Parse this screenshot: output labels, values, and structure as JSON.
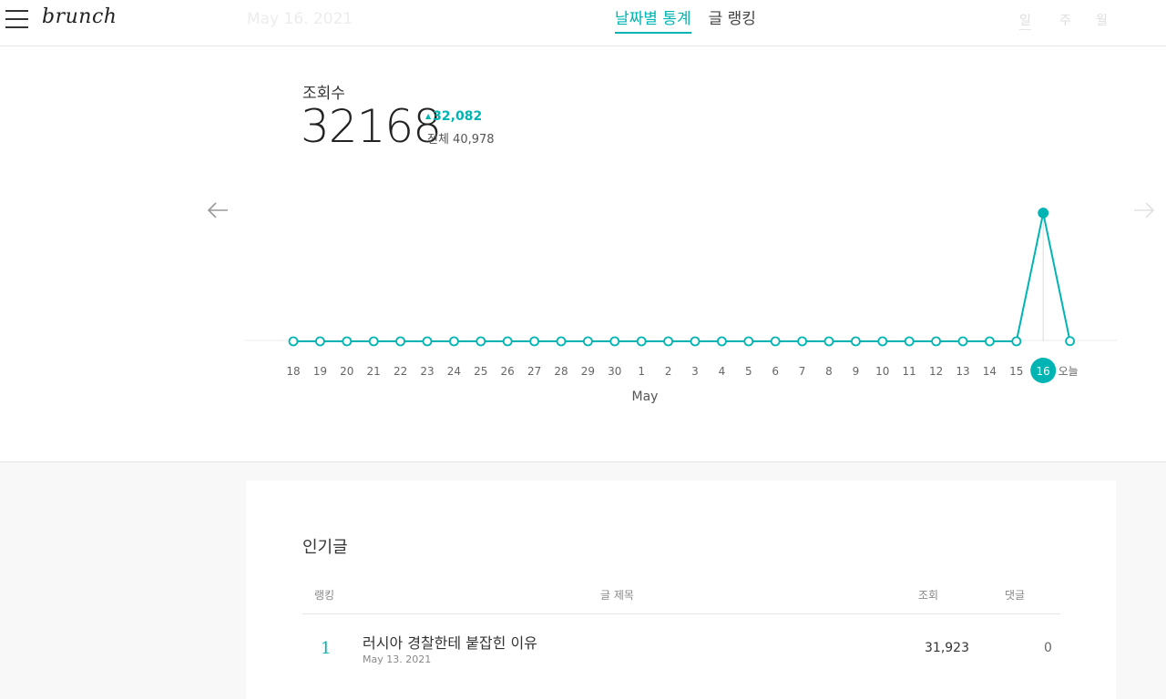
{
  "header": {
    "logo": "brunch",
    "date": "May 16. 2021",
    "tabs": [
      "날짜별 통계",
      "글 랭킹"
    ],
    "periods": [
      "일",
      "주",
      "월"
    ]
  },
  "stats": {
    "label": "조회수",
    "value": "32168",
    "change": "32,082",
    "total": "전체 40,978"
  },
  "chart_data": {
    "type": "line",
    "categories": [
      "18",
      "19",
      "20",
      "21",
      "22",
      "23",
      "24",
      "25",
      "26",
      "27",
      "28",
      "29",
      "30",
      "1",
      "2",
      "3",
      "4",
      "5",
      "6",
      "7",
      "8",
      "9",
      "10",
      "11",
      "12",
      "13",
      "14",
      "15",
      "16",
      "오늘"
    ],
    "values": [
      0,
      0,
      0,
      0,
      0,
      0,
      0,
      0,
      0,
      0,
      0,
      0,
      0,
      0,
      0,
      0,
      0,
      0,
      0,
      0,
      0,
      0,
      0,
      0,
      0,
      0,
      0,
      0,
      32168,
      50
    ],
    "xlabel": "May",
    "selected": "16",
    "ylim": [
      0,
      32168
    ]
  },
  "popular": {
    "title": "인기글",
    "columns": [
      "랭킹",
      "글 제목",
      "조회",
      "댓글"
    ],
    "rows": [
      {
        "rank": "1",
        "title": "러시아 경찰한테 붙잡힌 이유",
        "date": "May 13. 2021",
        "views": "31,923",
        "comments": "0"
      }
    ]
  },
  "colors": {
    "accent": "#00b4b4",
    "text": "#333333",
    "muted": "#888888"
  },
  "icons": [
    "menu-icon",
    "arrow-left-icon",
    "arrow-right-icon"
  ]
}
